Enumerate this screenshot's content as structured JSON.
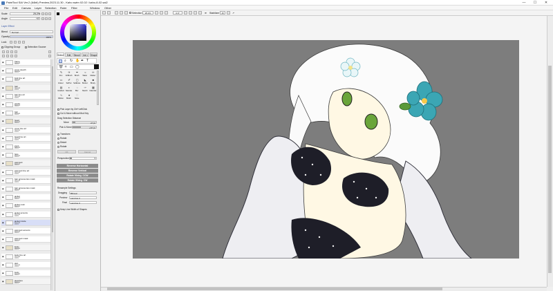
{
  "window": {
    "title": "PaintTool SAI Ver.2 (64bit) Preview.2023.11.30 - Kaho swim 02.02 / kaho-8-02.sai2",
    "minimize": "—",
    "maximize": "☐",
    "close": "✕"
  },
  "menu": [
    "File",
    "Edit",
    "Canvas",
    "Layer",
    "Selection",
    "Ruler",
    "Filter",
    "Window",
    "Other"
  ],
  "navigator": {
    "scale_label": "Scale",
    "scale_value": "25.2%",
    "angle_label": "Angle",
    "angle_value": "+0°"
  },
  "layer_panel": {
    "effect_label": "Layer Effect",
    "blend_label": "Blend",
    "blend_value": "Normal",
    "opacity_label": "Opacity",
    "opacity_value": "100%",
    "lock_label": "Lock",
    "clipping_label": "Clipping Group",
    "selection_source_label": "Selection Source"
  },
  "layers": [
    {
      "name": "frame",
      "mode": "Normal",
      "opacity": "100%",
      "kind": "layer",
      "selected": false
    },
    {
      "name": "cover sketch",
      "mode": "Normal",
      "opacity": "100%",
      "kind": "layer",
      "selected": false
    },
    {
      "name": "bulk line art",
      "mode": "Normal",
      "opacity": "100%",
      "kind": "layer",
      "selected": false
    },
    {
      "name": "hair",
      "mode": "Normal",
      "opacity": "100%",
      "kind": "folder",
      "selected": false
    },
    {
      "name": "hair line art",
      "mode": "Normal",
      "opacity": "100%",
      "kind": "layer",
      "selected": false
    },
    {
      "name": "peeks",
      "mode": "Normal",
      "opacity": "100%",
      "kind": "layer",
      "selected": false
    },
    {
      "name": "hair",
      "mode": "Normal",
      "opacity": "100%",
      "kind": "layer",
      "selected": false
    },
    {
      "name": "head",
      "mode": "Normal",
      "opacity": "100%",
      "kind": "folder",
      "selected": false
    },
    {
      "name": "cover line art",
      "mode": "Normal",
      "opacity": "100%",
      "kind": "layer",
      "selected": false
    },
    {
      "name": "head line art",
      "mode": "Normal",
      "opacity": "100%",
      "kind": "layer",
      "selected": false
    },
    {
      "name": "eyes",
      "mode": "Normal",
      "opacity": "100%",
      "kind": "layer",
      "selected": false
    },
    {
      "name": "face",
      "mode": "Normal",
      "opacity": "100%",
      "kind": "layer",
      "selected": false
    },
    {
      "name": "swimsuit",
      "mode": "Normal",
      "opacity": "100%",
      "kind": "folder",
      "selected": false
    },
    {
      "name": "swimsuit line art",
      "mode": "Normal",
      "opacity": "100%",
      "kind": "layer",
      "selected": false
    },
    {
      "name": "hair accessories mask",
      "mode": "Normal",
      "opacity": "100%",
      "kind": "layer",
      "selected": false
    },
    {
      "name": "hair accessories mask",
      "mode": "Normal",
      "opacity": "100%",
      "kind": "layer",
      "selected": false
    },
    {
      "name": "jacket",
      "mode": "Normal",
      "opacity": "100%",
      "kind": "layer",
      "selected": false
    },
    {
      "name": "jacket color",
      "mode": "Normal",
      "opacity": "100%",
      "kind": "layer",
      "selected": false
    },
    {
      "name": "jacket accents",
      "mode": "Normal",
      "opacity": "100%",
      "kind": "layer",
      "selected": false
    },
    {
      "name": "jacket inside",
      "mode": "Normal",
      "opacity": "100%",
      "kind": "layer",
      "selected": true
    },
    {
      "name": "swimsuit accents",
      "mode": "Normal",
      "opacity": "100%",
      "kind": "layer",
      "selected": false
    },
    {
      "name": "swimsuit mask",
      "mode": "Normal",
      "opacity": "100%",
      "kind": "layer",
      "selected": false
    },
    {
      "name": "body",
      "mode": "Normal",
      "opacity": "100%",
      "kind": "folder",
      "selected": false
    },
    {
      "name": "body line art",
      "mode": "Normal",
      "opacity": "100%",
      "kind": "layer",
      "selected": false
    },
    {
      "name": "skin",
      "mode": "Normal",
      "opacity": "100%",
      "kind": "layer",
      "selected": false
    },
    {
      "name": "body",
      "mode": "Normal",
      "opacity": "100%",
      "kind": "layer",
      "selected": false
    },
    {
      "name": "sketches",
      "mode": "Normal",
      "opacity": "100%",
      "kind": "folder",
      "selected": false
    }
  ],
  "tool_tabs": [
    "Select",
    "Edit",
    "Brush",
    "Ink 1",
    "Shape"
  ],
  "tools": [
    {
      "label": "Pen",
      "icon": "pen-icon",
      "glyph": "✎"
    },
    {
      "label": "AirBrush",
      "icon": "airbrush-icon",
      "glyph": "✈"
    },
    {
      "label": "Brush",
      "icon": "brush-icon",
      "glyph": "✒"
    },
    {
      "label": "Water",
      "icon": "water-icon",
      "glyph": "≈"
    },
    {
      "label": "Marker",
      "icon": "marker-icon",
      "glyph": "✏"
    },
    {
      "label": "Eraser",
      "icon": "eraser-icon",
      "glyph": "▭"
    },
    {
      "label": "SelPen",
      "icon": "select-pen-icon",
      "glyph": "✐"
    },
    {
      "label": "SelErase",
      "icon": "select-eraser-icon",
      "glyph": "▢"
    },
    {
      "label": "Bucket",
      "icon": "bucket-icon",
      "glyph": "◣"
    },
    {
      "label": "Binary",
      "icon": "binary-icon",
      "glyph": "■"
    },
    {
      "label": "Gradient",
      "icon": "gradient-icon",
      "glyph": "▤"
    },
    {
      "label": "Saturate",
      "icon": "saturate-icon",
      "glyph": "◐"
    },
    {
      "label": "Blur",
      "icon": "blur-icon",
      "glyph": "◌"
    },
    {
      "label": "Sketch",
      "icon": "sketch-icon",
      "glyph": "✑"
    },
    {
      "label": "Calendar",
      "icon": "calendar-icon",
      "glyph": "▦"
    },
    {
      "label": "Ribbon",
      "icon": "ribbon-icon",
      "glyph": "∿"
    },
    {
      "label": "Blotch",
      "icon": "blotch-icon",
      "glyph": "●"
    },
    {
      "label": "Noise",
      "icon": "noise-icon",
      "glyph": "∷"
    }
  ],
  "tool_options": {
    "pick_layer": "Pick Layer by Ctrl+LeftClick",
    "cut_move": "Cut & Move without Mod Key",
    "drag_title": "Drag Selection Distance",
    "move_label": "Move",
    "move_value": "+0 px",
    "pick_move_label": "Pick & Move",
    "pick_move_value": "+10 px",
    "transform_label": "Transform",
    "rotate_label": "Rotate",
    "distort_label": "Distort",
    "rotate2_label": "Rotate",
    "ok_label": "OK",
    "cancel_label": "Cancel",
    "perspective_label": "Perspective",
    "reverse_h": "Reverse Horizontal",
    "reverse_v": "Reverse Vertical",
    "rotate_ccw": "Rotate 90deg. CCW",
    "rotate_cw": "Rotate 90deg. CW",
    "resample_title": "Resample Settings",
    "dragging_label": "Dragging",
    "dragging_value": "Bilinear",
    "preview_label": "Preview",
    "preview_value": "Lanczos 2",
    "final_label": "Final",
    "final_value": "Lanczos 3",
    "keep_line": "Keep Line Width of Shapes"
  },
  "options_bar": {
    "selection_label": "Selection",
    "selection_value": "25.2%",
    "angle_value": "0.0°",
    "stabilizer_label": "Stabilizer",
    "stabilizer_value": "15"
  },
  "colors": {
    "canvas_bg": "#7d7d7d",
    "hair_flower": "#3ba6b4",
    "accent_dark": "#1e1e28"
  }
}
